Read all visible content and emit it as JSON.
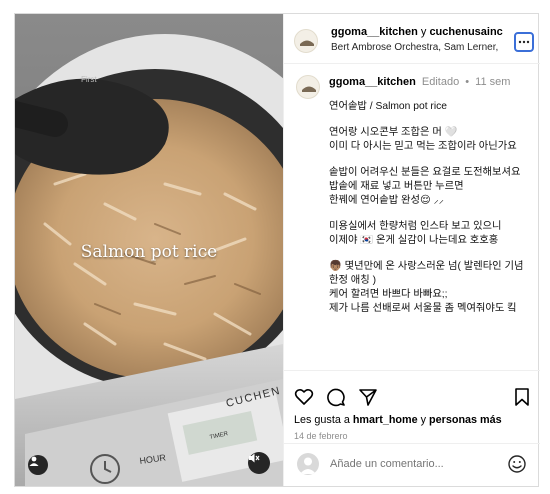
{
  "header": {
    "account_primary": "ggoma__kitchen",
    "connector": "y",
    "account_secondary": "cuchenusainc",
    "audio_line": "Bert Ambrose Orchestra, Sam Lerner, ..."
  },
  "media": {
    "overlay_text": "Salmon pot rice",
    "label_pot_text": "First",
    "label_brand": "CUCHEN",
    "label_hour": "HOUR",
    "label_timer": "TIMER",
    "user_tag_icon": "user-silhouette-icon",
    "mute_icon": "speaker-muted-icon"
  },
  "post": {
    "username": "ggoma__kitchen",
    "edited": "Editado",
    "separator": "•",
    "age": "11 sem",
    "caption_lines": [
      "연어솥밥 / Salmon pot rice",
      "",
      "연어랑 시오콘부 조합은 머 🤍",
      "이미 다 아시는 믿고 먹는 조합이라 아닌가요",
      "",
      "솥밥이 어려우신 분들은 요걸로 도전해보셔요",
      "밥솥에 재료 넣고 버튼만 누르면",
      "한꿰에 연어솥밥 완성😌 ⸝⸝",
      "",
      "미용실에서 한량처럼 인스타 보고 있으니",
      "이제야 🇰🇷 온게 실감이 나는데요 호호홍",
      "",
      "👦🏽 몇년만에 온 사랑스러운 넘( 발렌타인 기념",
      "한정 애칭 )",
      "케어 할려면 바쁘다 바빠요;;",
      "제가 나름 선배로써 서울물 좀 멕여줘야도 킼"
    ]
  },
  "actions": {
    "like_icon": "heart-icon",
    "comment_icon": "comment-bubble-icon",
    "share_icon": "paper-plane-icon",
    "save_icon": "bookmark-icon",
    "likes_prefix": "Les gusta a",
    "likes_user": "hmart_home",
    "likes_connector": "y",
    "likes_others": "personas más",
    "date": "14 de febrero"
  },
  "add_comment": {
    "placeholder": "Añade un comentario...",
    "emoji_icon": "smiley-icon"
  },
  "colors": {
    "accent_focus": "#3b6fd8",
    "muted_text": "#8e8e8e",
    "border": "#dbdbdb"
  }
}
